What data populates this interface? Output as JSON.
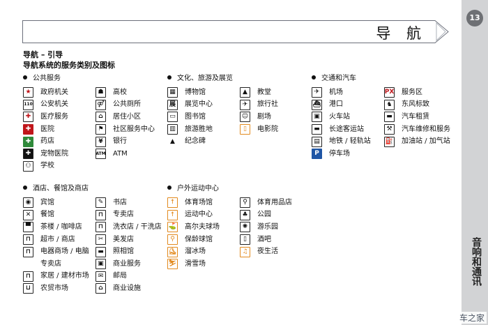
{
  "banner": {
    "title": "导 航"
  },
  "side": {
    "page_number": "13",
    "chapter": "音响和通讯",
    "watermark": "车之家"
  },
  "headings": {
    "line1": "导航 – 引导",
    "line2": "导航系统的服务类别及图标"
  },
  "sections": {
    "public": {
      "title": "公共服务",
      "col1": [
        {
          "icon": "government-office-icon",
          "glyph": "★",
          "style": "red",
          "label": "政府机关"
        },
        {
          "icon": "police-icon",
          "glyph": "110",
          "style": "light",
          "label": "公安机关"
        },
        {
          "icon": "medical-service-icon",
          "glyph": "✚",
          "style": "red",
          "label": "医疗服务"
        },
        {
          "icon": "hospital-icon",
          "glyph": "✚",
          "style": "redfill",
          "label": "医院"
        },
        {
          "icon": "pharmacy-icon",
          "glyph": "✚",
          "style": "greenfill",
          "label": "药店"
        },
        {
          "icon": "pet-hospital-icon",
          "glyph": "✚",
          "style": "dark",
          "label": "宠物医院"
        },
        {
          "icon": "school-icon",
          "glyph": "⚇",
          "style": "light",
          "label": "学校"
        }
      ],
      "col2": [
        {
          "icon": "college-icon",
          "glyph": "☗",
          "style": "light",
          "label": "高校"
        },
        {
          "icon": "public-toilet-icon",
          "glyph": "⚤",
          "style": "light",
          "label": "公共厕所"
        },
        {
          "icon": "residential-area-icon",
          "glyph": "⌂",
          "style": "light",
          "label": "居住小区"
        },
        {
          "icon": "community-center-icon",
          "glyph": "⚑",
          "style": "light",
          "label": "社区服务中心"
        },
        {
          "icon": "bank-icon",
          "glyph": "¥",
          "style": "light",
          "label": "银行"
        },
        {
          "icon": "atm-icon",
          "glyph": "ATM",
          "style": "light",
          "label": "ATM"
        }
      ]
    },
    "culture": {
      "title": "文化、旅游及展览",
      "col1": [
        {
          "icon": "museum-icon",
          "glyph": "▦",
          "style": "light",
          "label": "博物馆"
        },
        {
          "icon": "exhibition-center-icon",
          "glyph": "展",
          "style": "light",
          "label": "展览中心"
        },
        {
          "icon": "library-icon",
          "glyph": "▭",
          "style": "light",
          "label": "图书馆"
        },
        {
          "icon": "scenic-spot-icon",
          "glyph": "▥",
          "style": "light",
          "label": "旅游胜地"
        },
        {
          "icon": "monument-icon",
          "glyph": "▲",
          "style": "none",
          "label": "纪念碑"
        }
      ],
      "col2": [
        {
          "icon": "church-icon",
          "glyph": "▲",
          "style": "light",
          "label": "教堂"
        },
        {
          "icon": "travel-agency-icon",
          "glyph": "✈",
          "style": "light",
          "label": "旅行社"
        },
        {
          "icon": "theater-icon",
          "glyph": "☺",
          "style": "light",
          "label": "剧场"
        },
        {
          "icon": "cinema-icon",
          "glyph": "▯",
          "style": "orange",
          "label": "电影院"
        }
      ]
    },
    "transport": {
      "title": "交通和汽车",
      "col1": [
        {
          "icon": "airport-icon",
          "glyph": "✈",
          "style": "light",
          "label": "机场"
        },
        {
          "icon": "port-icon",
          "glyph": "⛴",
          "style": "light",
          "label": "港口"
        },
        {
          "icon": "railway-station-icon",
          "glyph": "▣",
          "style": "light",
          "label": "火车站"
        },
        {
          "icon": "bus-station-icon",
          "glyph": "▬",
          "style": "light",
          "label": "长途客运站"
        },
        {
          "icon": "subway-icon",
          "glyph": "▤",
          "style": "light",
          "label": "地铁 / 轻轨站"
        },
        {
          "icon": "parking-icon",
          "glyph": "P",
          "style": "blue",
          "label": "停车场"
        }
      ],
      "col2": [
        {
          "icon": "service-area-icon",
          "glyph": "PX",
          "style": "red",
          "label": "服务区"
        },
        {
          "icon": "dongfeng-peugeot-icon",
          "glyph": "♞",
          "style": "light",
          "label": "东风标致"
        },
        {
          "icon": "car-rental-icon",
          "glyph": "▬",
          "style": "light",
          "label": "汽车租赁"
        },
        {
          "icon": "car-repair-icon",
          "glyph": "⚒",
          "style": "light",
          "label": "汽车维修和服务"
        },
        {
          "icon": "gas-station-icon",
          "glyph": "⛽",
          "style": "light",
          "label": "加油站 / 加气站"
        }
      ]
    },
    "hotel": {
      "title": "酒店、餐馆及商店",
      "col1": [
        {
          "icon": "hotel-icon",
          "glyph": "◉",
          "style": "light",
          "label": "宾馆"
        },
        {
          "icon": "restaurant-icon",
          "glyph": "✕",
          "style": "light",
          "label": "餐馆"
        },
        {
          "icon": "cafe-icon",
          "glyph": "▀",
          "style": "light",
          "label": "茶楼 / 咖啡店"
        },
        {
          "icon": "supermarket-icon",
          "glyph": "⊓",
          "style": "light",
          "label": "超市 / 商店"
        },
        {
          "icon": "electronics-store-icon",
          "glyph": "⊓",
          "style": "light",
          "label": "电器商场 / 电脑"
        },
        {
          "icon": "specialty-store-icon",
          "glyph": "",
          "style": "hidden",
          "label": "专卖店"
        },
        {
          "icon": "furniture-store-icon",
          "glyph": "⊓",
          "style": "light",
          "label": "家居 / 建材市场"
        },
        {
          "icon": "farmers-market-icon",
          "glyph": "⊔",
          "style": "light",
          "label": "农贸市场"
        }
      ],
      "col2": [
        {
          "icon": "bookstore-icon",
          "glyph": "✎",
          "style": "light",
          "label": "书店"
        },
        {
          "icon": "takeaway-icon",
          "glyph": "⊓",
          "style": "light",
          "label": "专卖店"
        },
        {
          "icon": "laundry-icon",
          "glyph": "⊓",
          "style": "light",
          "label": "洗衣店 / 干洗店"
        },
        {
          "icon": "hair-salon-icon",
          "glyph": "✂",
          "style": "light",
          "label": "美发店"
        },
        {
          "icon": "photo-studio-icon",
          "glyph": "▬",
          "style": "light",
          "label": "照相馆"
        },
        {
          "icon": "business-service-icon",
          "glyph": "▣",
          "style": "light",
          "label": "商业服务"
        },
        {
          "icon": "post-office-icon",
          "glyph": "✉",
          "style": "light",
          "label": "邮局"
        },
        {
          "icon": "commercial-facility-icon",
          "glyph": "⌂",
          "style": "light",
          "label": "商业设施"
        }
      ]
    },
    "outdoor": {
      "title": "户外运动中心",
      "col1": [
        {
          "icon": "stadium-icon",
          "glyph": "☨",
          "style": "orange",
          "label": "体育场馆"
        },
        {
          "icon": "sports-center-icon",
          "glyph": "☨",
          "style": "orange",
          "label": "运动中心"
        },
        {
          "icon": "golf-course-icon",
          "glyph": "⛳",
          "style": "orange",
          "label": "高尔夫球场"
        },
        {
          "icon": "bowling-alley-icon",
          "glyph": "⚲",
          "style": "orange",
          "label": "保龄球馆"
        },
        {
          "icon": "ice-rink-icon",
          "glyph": "⛸",
          "style": "orange",
          "label": "溜冰场"
        },
        {
          "icon": "ski-resort-icon",
          "glyph": "⛷",
          "style": "orange",
          "label": "滑雪场"
        }
      ],
      "col2": [
        {
          "icon": "sporting-goods-icon",
          "glyph": "⚲",
          "style": "light",
          "label": "体育用品店"
        },
        {
          "icon": "park-icon",
          "glyph": "♣",
          "style": "light",
          "label": "公园"
        },
        {
          "icon": "amusement-park-icon",
          "glyph": "✺",
          "style": "light",
          "label": "游乐园"
        },
        {
          "icon": "bar-icon",
          "glyph": "▯",
          "style": "light",
          "label": "酒吧"
        },
        {
          "icon": "nightlife-icon",
          "glyph": "♫",
          "style": "orange",
          "label": "夜生活"
        }
      ]
    }
  }
}
